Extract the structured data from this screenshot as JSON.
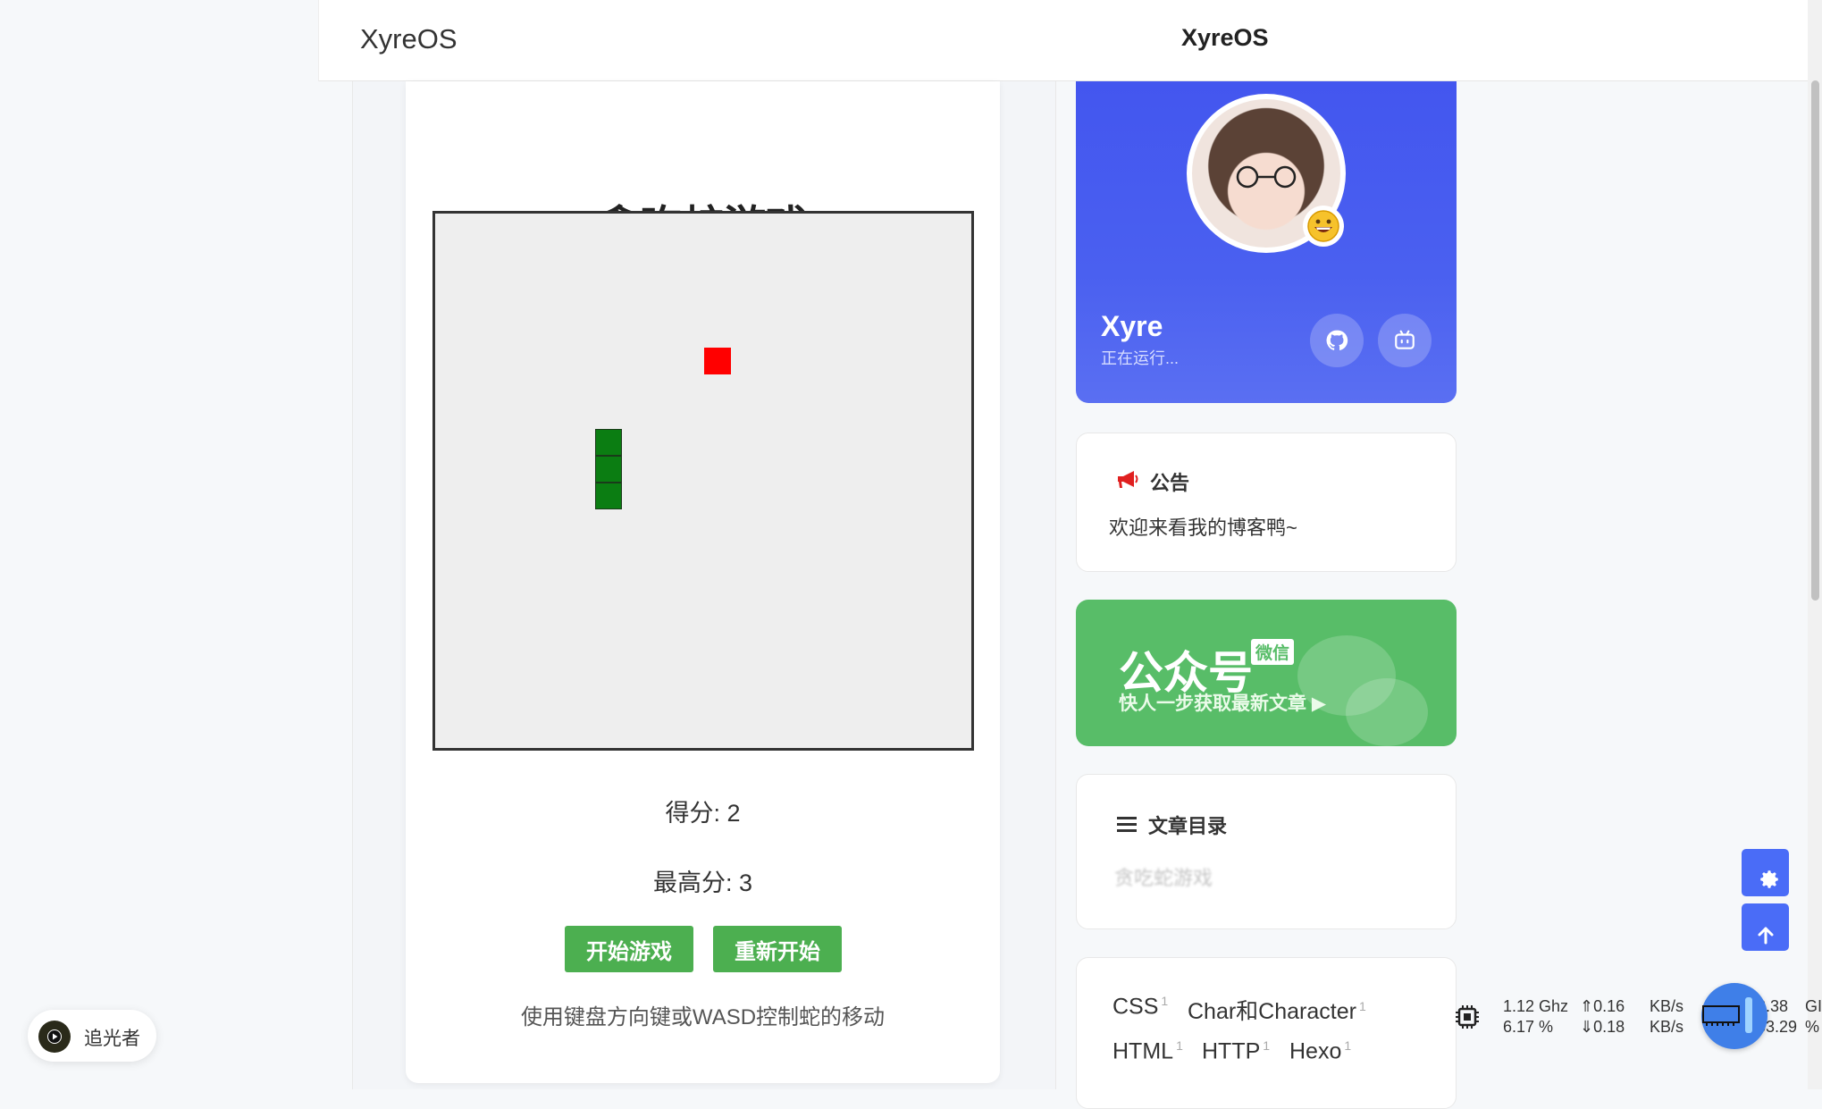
{
  "header": {
    "brand": "XyreOS",
    "center_title": "XyreOS"
  },
  "game": {
    "title": "贪吃蛇游戏",
    "score_text": "得分: 2",
    "high_score_text": "最高分: 3",
    "start_label": "开始游戏",
    "restart_label": "重新开始",
    "hint": "使用键盘方向键或WASD控制蛇的移动",
    "snake_color": "#0b7d12",
    "food_color": "#ff0000",
    "board_color": "#eeeeee"
  },
  "profile": {
    "name": "Xyre",
    "status": "正在运行..."
  },
  "notice": {
    "title": "公告",
    "text": "欢迎来看我的博客鸭~"
  },
  "wechat": {
    "title": "公众号",
    "tag": "微信",
    "subtitle": "快人一步获取最新文章 ▶"
  },
  "toc": {
    "title": "文章目录",
    "items": [
      "贪吃蛇游戏"
    ]
  },
  "tags": [
    {
      "label": "CSS",
      "count": "1"
    },
    {
      "label": "Char和Character",
      "count": "1"
    },
    {
      "label": "HTML",
      "count": "1"
    },
    {
      "label": "HTTP",
      "count": "1"
    },
    {
      "label": "Hexo",
      "count": "1"
    }
  ],
  "music": {
    "title": "追光者"
  },
  "monitor": {
    "cpu_freq": "1.12 Ghz",
    "cpu_usage": "6.17 %",
    "up": "⇑0.16",
    "down": "⇓0.18",
    "up_unit": "KB/s",
    "down_unit": "KB/s",
    "mem_val": "8.38",
    "mem_pct": "53.29",
    "mem_unit": "GI",
    "mem_pct_unit": "%"
  }
}
